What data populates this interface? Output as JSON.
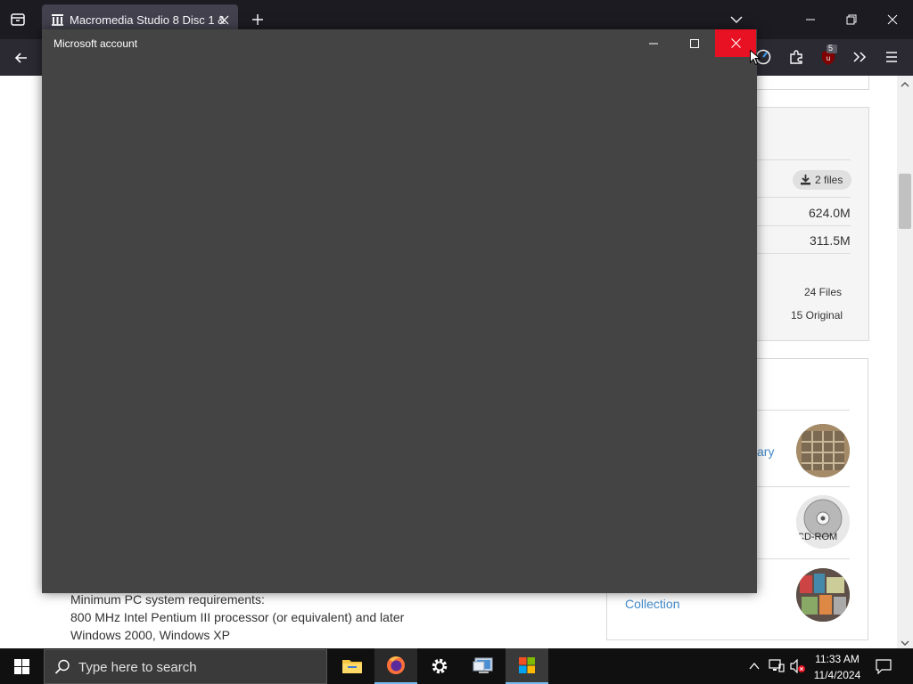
{
  "browser": {
    "tab_title": "Macromedia Studio 8 Disc 1 &",
    "extension_badge": "5"
  },
  "page": {
    "files_button": "2 files",
    "size_1": "624.0M",
    "size_2": "311.5M",
    "files_count": "24 Files",
    "original_count": "15 Original",
    "partial_link": "ary",
    "collection_link": "Collection",
    "thumb_label": "CD-ROM",
    "requirements": [
      "Minimum PC system requirements:",
      "800 MHz Intel Pentium III processor (or equivalent) and later",
      "Windows 2000, Windows XP"
    ]
  },
  "dialog": {
    "title": "Microsoft account"
  },
  "taskbar": {
    "search_placeholder": "Type here to search",
    "time": "11:33 AM",
    "date": "11/4/2024"
  },
  "colors": {
    "close_red": "#e81123",
    "dialog_bg": "#444444",
    "link_blue": "#428bca"
  }
}
